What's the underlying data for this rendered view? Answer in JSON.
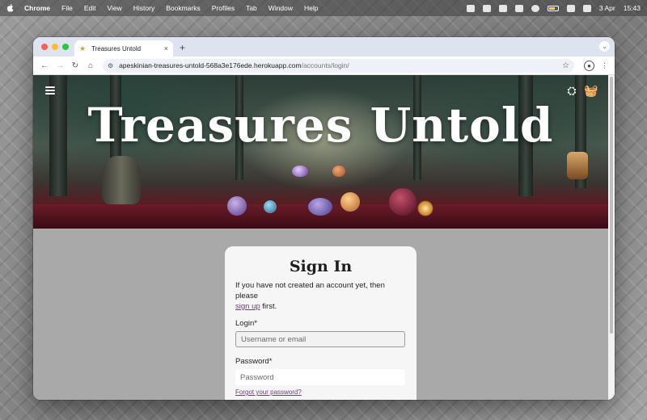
{
  "menubar": {
    "app": "Chrome",
    "items": [
      "File",
      "Edit",
      "View",
      "History",
      "Bookmarks",
      "Profiles",
      "Tab",
      "Window",
      "Help"
    ],
    "date": "3 Apr",
    "time": "15:43"
  },
  "browser": {
    "tab_title": "Treasures Untold",
    "new_tab": "+",
    "tab_close": "×",
    "url_host": "apeskinian-treasures-untold-568a3e176ede.herokuapp.com",
    "url_path": "/accounts/login/"
  },
  "site": {
    "title": "Treasures Untold"
  },
  "signin": {
    "title": "Sign In",
    "intro_text": "If you have not created an account yet, then please",
    "signup_link": "sign up",
    "intro_suffix": " first.",
    "login_label": "Login*",
    "login_placeholder": "Username or email",
    "password_label": "Password*",
    "password_placeholder": "Password",
    "forgot_link": "Forgot your password?"
  }
}
